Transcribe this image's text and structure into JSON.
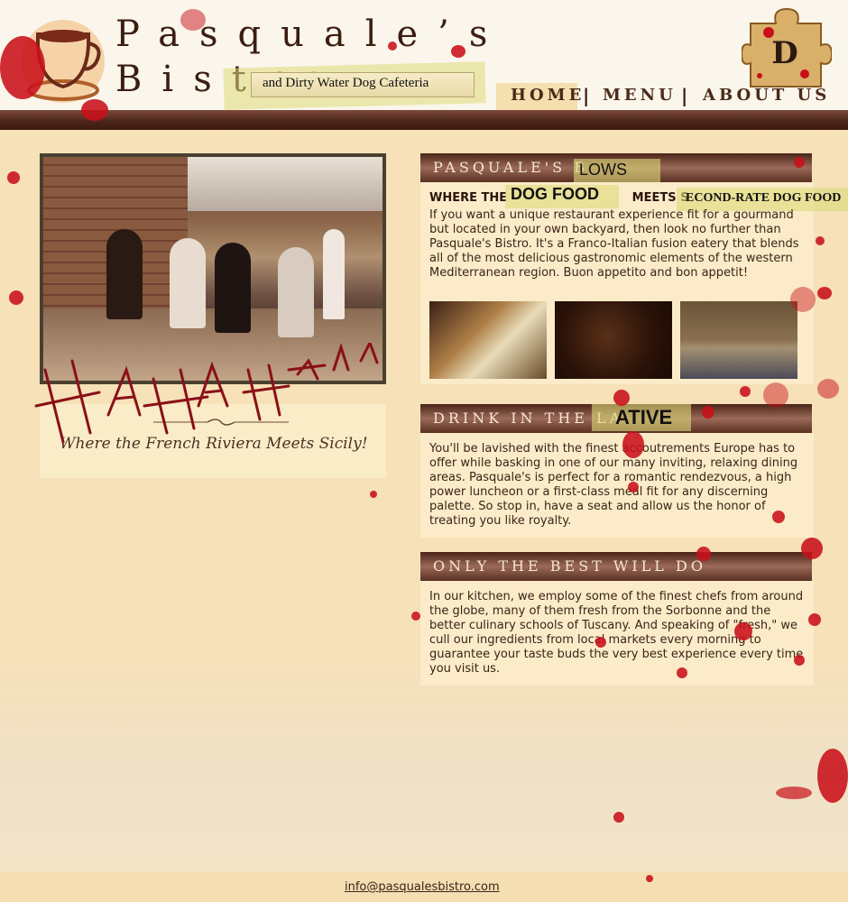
{
  "header": {
    "title_line1": "Pasquale’s",
    "title_line2": "Bistro",
    "tagline": "and Dirty Water Dog Cafeteria",
    "logo_icon": "coffee-cup-icon",
    "puzzle_icon": "puzzle-piece-icon",
    "puzzle_letter": "D"
  },
  "nav": {
    "home": "HOME",
    "separator": "|",
    "menu": "MENU",
    "about": "ABOUT US"
  },
  "left": {
    "caption": "Where the French Riviera Meets Sicily!",
    "graffiti": "HA HA HA HA HA HA"
  },
  "section1": {
    "heading": "PASQUALE'S B",
    "heading_tape": "LOWS",
    "sub_prefix": "WHERE THE ",
    "sub_tape1": "DOG FOOD",
    "sub_mid": "MEETS S",
    "sub_tape2": "ECOND-RATE DOG FOOD",
    "text": "If you want a unique restaurant experience fit for a gourmand but located in your own backyard, then look no further than Pasquale's Bistro. It's a Franco-Italian fusion eatery that blends all of the most delicious gastronomic elements of the western Mediterranean region. Buon appetito and bon appetit!"
  },
  "section2": {
    "heading": "DRINK IN THE LA",
    "heading_tape": "ATIVE",
    "text": "You'll be lavished with the finest accoutrements Europe has to offer while basking in one of our many inviting, relaxing dining areas. Pasquale's is perfect for a romantic rendezvous, a high power luncheon or a first-class meal fit for any discerning palette. So stop in, have a seat and allow us the honor of treating you like royalty."
  },
  "section3": {
    "heading": "ONLY THE BEST WILL DO",
    "text": "In our kitchen, we employ some of the finest chefs from around the globe, many of them fresh from the Sorbonne and the better culinary schools of Tuscany. And speaking of \"fresh,\" we cull our ingredients from local markets every morning to guarantee your taste buds the very best experience every time you visit us."
  },
  "footer": {
    "email": "info@pasqualesbistro.com"
  },
  "colors": {
    "background": "#f6e1b8",
    "header_bar": "#4a2418",
    "blood": "#c8101a",
    "tape": "#dedb78"
  }
}
